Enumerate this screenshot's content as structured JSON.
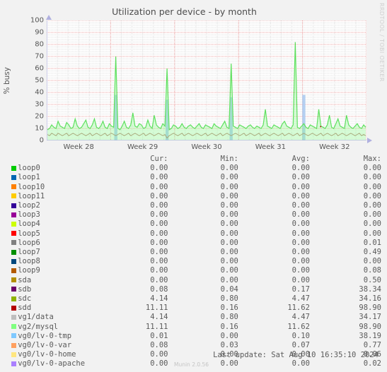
{
  "watermark": "RRDTOOL / TOBI OETIKER",
  "footer": {
    "last_update": "Last update: Sat Aug 10 16:35:10 2024",
    "version": "Munin 2.0.56"
  },
  "legend": {
    "headers": [
      "",
      "Cur:",
      "Min:",
      "Avg:",
      "Max:"
    ],
    "rows": [
      {
        "name": "loop0",
        "color": "#00cc00",
        "cur": "0.00",
        "min": "0.00",
        "avg": "0.00",
        "max": "0.00"
      },
      {
        "name": "loop1",
        "color": "#0066b3",
        "cur": "0.00",
        "min": "0.00",
        "avg": "0.00",
        "max": "0.00"
      },
      {
        "name": "loop10",
        "color": "#ff8000",
        "cur": "0.00",
        "min": "0.00",
        "avg": "0.00",
        "max": "0.00"
      },
      {
        "name": "loop11",
        "color": "#ffcc00",
        "cur": "0.00",
        "min": "0.00",
        "avg": "0.00",
        "max": "0.00"
      },
      {
        "name": "loop2",
        "color": "#330099",
        "cur": "0.00",
        "min": "0.00",
        "avg": "0.00",
        "max": "0.00"
      },
      {
        "name": "loop3",
        "color": "#990099",
        "cur": "0.00",
        "min": "0.00",
        "avg": "0.00",
        "max": "0.00"
      },
      {
        "name": "loop4",
        "color": "#ccff00",
        "cur": "0.00",
        "min": "0.00",
        "avg": "0.00",
        "max": "0.00"
      },
      {
        "name": "loop5",
        "color": "#ff0000",
        "cur": "0.00",
        "min": "0.00",
        "avg": "0.00",
        "max": "0.00"
      },
      {
        "name": "loop6",
        "color": "#808080",
        "cur": "0.00",
        "min": "0.00",
        "avg": "0.00",
        "max": "0.01"
      },
      {
        "name": "loop7",
        "color": "#008f00",
        "cur": "0.00",
        "min": "0.00",
        "avg": "0.00",
        "max": "0.49"
      },
      {
        "name": "loop8",
        "color": "#00487d",
        "cur": "0.00",
        "min": "0.00",
        "avg": "0.00",
        "max": "0.00"
      },
      {
        "name": "loop9",
        "color": "#b35a00",
        "cur": "0.00",
        "min": "0.00",
        "avg": "0.00",
        "max": "0.08"
      },
      {
        "name": "sda",
        "color": "#b38f00",
        "cur": "0.00",
        "min": "0.00",
        "avg": "0.00",
        "max": "0.50"
      },
      {
        "name": "sdb",
        "color": "#6b006b",
        "cur": "0.08",
        "min": "0.04",
        "avg": "0.17",
        "max": "38.34"
      },
      {
        "name": "sdc",
        "color": "#8fb300",
        "cur": "4.14",
        "min": "0.80",
        "avg": "4.47",
        "max": "34.16"
      },
      {
        "name": "sdd",
        "color": "#b30000",
        "cur": "11.11",
        "min": "0.16",
        "avg": "11.62",
        "max": "98.90"
      },
      {
        "name": "vg1/data",
        "color": "#bebebe",
        "cur": "4.14",
        "min": "0.80",
        "avg": "4.47",
        "max": "34.17"
      },
      {
        "name": "vg2/mysql",
        "color": "#80ff80",
        "cur": "11.11",
        "min": "0.16",
        "avg": "11.62",
        "max": "98.90"
      },
      {
        "name": "vg0/lv-0-tmp",
        "color": "#80c9ff",
        "cur": "0.01",
        "min": "0.00",
        "avg": "0.10",
        "max": "38.19"
      },
      {
        "name": "vg0/lv-0-var",
        "color": "#ffa060",
        "cur": "0.08",
        "min": "0.03",
        "avg": "0.07",
        "max": "0.77"
      },
      {
        "name": "vg0/lv-0-home",
        "color": "#ffe680",
        "cur": "0.00",
        "min": "0.00",
        "avg": "0.00",
        "max": "0.06"
      },
      {
        "name": "vg0/lv-0-apache",
        "color": "#aa80ff",
        "cur": "0.00",
        "min": "0.00",
        "avg": "0.00",
        "max": "0.02"
      }
    ]
  },
  "chart_data": {
    "type": "line",
    "title": "Utilization per device - by month",
    "xlabel": "",
    "ylabel": "% busy",
    "ylim": [
      0,
      100
    ],
    "yticks": [
      0,
      10,
      20,
      30,
      40,
      50,
      60,
      70,
      80,
      90,
      100
    ],
    "xticks": [
      "Week 28",
      "Week 29",
      "Week 30",
      "Week 31",
      "Week 32"
    ],
    "grid": true,
    "legend_position": "below-as-table",
    "series": [
      {
        "name": "vg2/mysql",
        "color": "#80ff80",
        "x": [
          0,
          1,
          2,
          3,
          4,
          5,
          6,
          7,
          8,
          9,
          10,
          11,
          12,
          13,
          14,
          15,
          16,
          17,
          18,
          19,
          20,
          21,
          22,
          23,
          24,
          25,
          26,
          27,
          28,
          29,
          30,
          31,
          32,
          33,
          34,
          35,
          36,
          37,
          38,
          39,
          40,
          41,
          42,
          43,
          44,
          45,
          46,
          47,
          48,
          49,
          50,
          51,
          52,
          53,
          54,
          55,
          56,
          57,
          58,
          59,
          60,
          61,
          62,
          63,
          64,
          65,
          66,
          67,
          68,
          69,
          70,
          71,
          72,
          73,
          74,
          75,
          76,
          77,
          78,
          79,
          80,
          81,
          82,
          83,
          84,
          85,
          86,
          87,
          88,
          89,
          90,
          91,
          92,
          93,
          94,
          95,
          96,
          97,
          98,
          99,
          100,
          101,
          102,
          103,
          104,
          105,
          106,
          107,
          108,
          109,
          110,
          111,
          112,
          113,
          114,
          115,
          116,
          117,
          118,
          119,
          120,
          121,
          122,
          123,
          124,
          125,
          126,
          127,
          128,
          129,
          130,
          131,
          132,
          133,
          134,
          135,
          136,
          137,
          138,
          139,
          140,
          141,
          142,
          143,
          144,
          145,
          146,
          147,
          148,
          149
        ],
        "values": [
          9,
          10,
          13,
          11,
          10,
          16,
          12,
          11,
          10,
          15,
          13,
          10,
          11,
          18,
          12,
          10,
          11,
          14,
          17,
          11,
          10,
          13,
          18,
          11,
          10,
          12,
          16,
          11,
          10,
          14,
          12,
          11,
          70,
          10,
          9,
          12,
          16,
          11,
          10,
          13,
          23,
          12,
          11,
          14,
          13,
          10,
          11,
          17,
          12,
          10,
          21,
          13,
          11,
          10,
          14,
          12,
          60,
          9,
          10,
          13,
          12,
          10,
          11,
          14,
          11,
          10,
          12,
          13,
          11,
          10,
          12,
          14,
          11,
          10,
          13,
          12,
          11,
          10,
          14,
          12,
          11,
          10,
          13,
          16,
          11,
          10,
          64,
          12,
          11,
          10,
          13,
          12,
          11,
          10,
          12,
          13,
          11,
          10,
          12,
          11,
          10,
          13,
          26,
          12,
          11,
          10,
          13,
          12,
          11,
          10,
          14,
          16,
          12,
          11,
          10,
          13,
          82,
          11,
          10,
          12,
          14,
          11,
          10,
          13,
          12,
          11,
          10,
          26,
          12,
          11,
          10,
          13,
          21,
          11,
          10,
          14,
          18,
          12,
          11,
          10,
          21,
          13,
          11,
          10,
          12,
          14,
          11,
          10,
          13,
          11
        ]
      },
      {
        "name": "vg1/data",
        "color": "#a8a87a",
        "x": [
          0,
          1,
          2,
          3,
          4,
          5,
          6,
          7,
          8,
          9,
          10,
          11,
          12,
          13,
          14,
          15,
          16,
          17,
          18,
          19,
          20,
          21,
          22,
          23,
          24,
          25,
          26,
          27,
          28,
          29,
          30,
          31,
          32,
          33,
          34,
          35,
          36,
          37,
          38,
          39,
          40,
          41,
          42,
          43,
          44,
          45,
          46,
          47,
          48,
          49,
          50,
          51,
          52,
          53,
          54,
          55,
          56,
          57,
          58,
          59,
          60,
          61,
          62,
          63,
          64,
          65,
          66,
          67,
          68,
          69,
          70,
          71,
          72,
          73,
          74,
          75,
          76,
          77,
          78,
          79,
          80,
          81,
          82,
          83,
          84,
          85,
          86,
          87,
          88,
          89,
          90,
          91,
          92,
          93,
          94,
          95,
          96,
          97,
          98,
          99,
          100,
          101,
          102,
          103,
          104,
          105,
          106,
          107,
          108,
          109,
          110,
          111,
          112,
          113,
          114,
          115,
          116,
          117,
          118,
          119,
          120,
          121,
          122,
          123,
          124,
          125,
          126,
          127,
          128,
          129,
          130,
          131,
          132,
          133,
          134,
          135,
          136,
          137,
          138,
          139,
          140,
          141,
          142,
          143,
          144,
          145,
          146,
          147,
          148,
          149
        ],
        "values": [
          5,
          4,
          6,
          5,
          4,
          6,
          5,
          4,
          5,
          6,
          4,
          5,
          6,
          5,
          4,
          5,
          6,
          5,
          4,
          5,
          6,
          4,
          5,
          6,
          5,
          4,
          5,
          6,
          4,
          5,
          6,
          5,
          4,
          5,
          6,
          5,
          4,
          5,
          6,
          4,
          5,
          6,
          5,
          4,
          5,
          6,
          4,
          5,
          6,
          5,
          4,
          5,
          6,
          5,
          4,
          5,
          2,
          4,
          5,
          6,
          5,
          4,
          5,
          6,
          4,
          5,
          6,
          5,
          4,
          5,
          6,
          5,
          4,
          5,
          6,
          4,
          5,
          6,
          5,
          4,
          5,
          6,
          4,
          5,
          6,
          5,
          4,
          5,
          6,
          5,
          4,
          5,
          6,
          4,
          5,
          6,
          5,
          4,
          5,
          6,
          4,
          5,
          6,
          5,
          4,
          5,
          6,
          5,
          4,
          5,
          6,
          4,
          5,
          6,
          5,
          4,
          5,
          6,
          4,
          5,
          6,
          5,
          4,
          5,
          6,
          5,
          4,
          5,
          6,
          4,
          5,
          6,
          5,
          4,
          5,
          6,
          4,
          5,
          6,
          5,
          4,
          5,
          6,
          5,
          4,
          5,
          6,
          4,
          5,
          4
        ]
      },
      {
        "name": "vg0/lv-0-tmp",
        "color": "#80c9ff",
        "x": [
          32,
          56,
          86,
          120
        ],
        "values": [
          38,
          34,
          36,
          38
        ]
      }
    ]
  }
}
